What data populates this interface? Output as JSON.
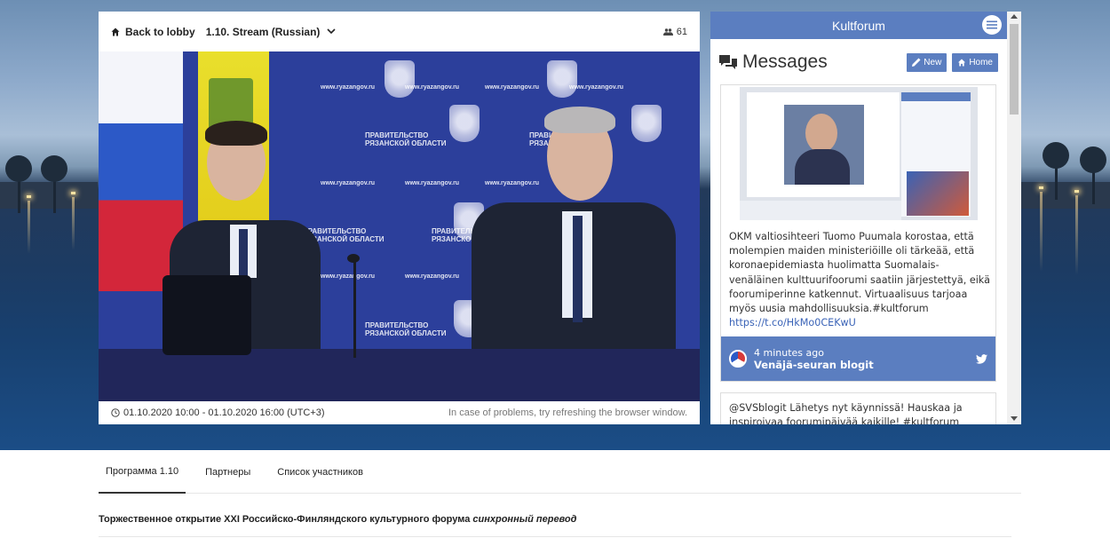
{
  "stream": {
    "back_label": "Back to lobby",
    "stream_name": "1.10. Stream (Russian)",
    "viewer_count": "61",
    "date_range": "01.10.2020 10:00 - 01.10.2020 16:00 (UTC+3)",
    "problem_hint": "In case of problems, try refreshing the browser window."
  },
  "chat": {
    "title": "Kultforum",
    "section_title": "Messages",
    "new_label": "New",
    "home_label": "Home",
    "messages": [
      {
        "text": "OKM valtiosihteeri Tuomo Puumala korostaa, että molempien maiden ministeriöille oli tärkeää, että koronaepidemiasta huolimatta Suomalais-venäläinen kulttuurifoorumi saatiin järjestettyä, eikä foorumiperinne katkennut. Virtuaalisuus tarjoaa myös uusia mahdollisuuksia.#kultforum",
        "link": "https://t.co/HkMo0CEKwU",
        "time": "4 minutes ago",
        "author": "Venäjä-seuran blogit"
      },
      {
        "text": "@SVSblogit Lähetys nyt käynnissä! Hauskaa ja inspiroivaa foorumipäivää kaikille! #kultforum"
      }
    ]
  },
  "tabs": [
    {
      "label": "Программа 1.10"
    },
    {
      "label": "Партнеры"
    },
    {
      "label": "Список участников"
    }
  ],
  "program": {
    "title": "Торжественное открытие XXI Российско-Финляндского культурного форума",
    "title_suffix": "синхронный перевод"
  },
  "colors": {
    "accent": "#5b7ec0",
    "link": "#3a63b7"
  },
  "icons": {
    "back": "home-icon",
    "dropdown": "chevron-down-icon",
    "viewers": "people-icon",
    "date": "clock-icon",
    "menu": "hamburger-icon",
    "messages": "comments-icon",
    "new": "pencil-icon",
    "home": "home-icon",
    "twitter": "twitter-icon"
  }
}
